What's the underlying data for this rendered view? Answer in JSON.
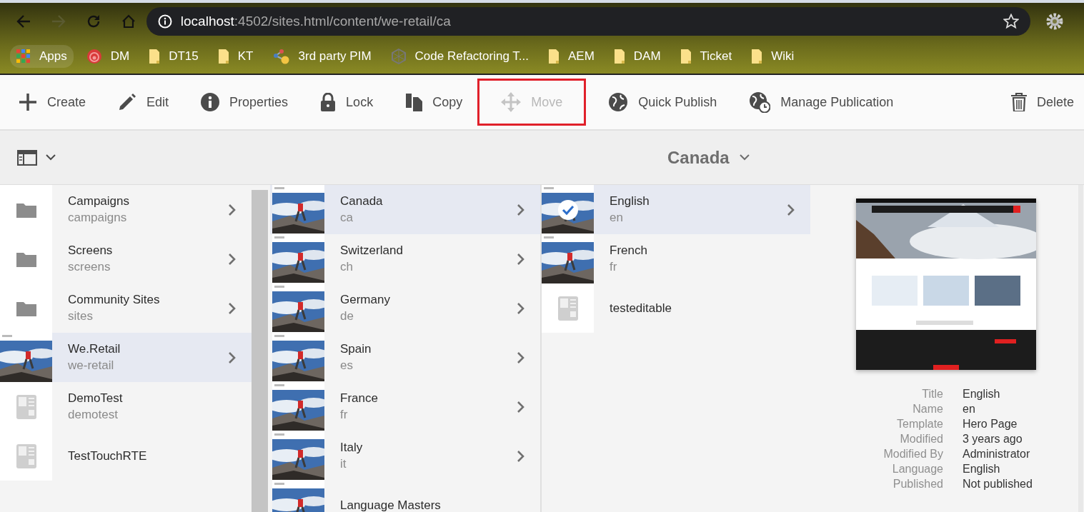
{
  "browser": {
    "address": {
      "host": "localhost",
      "path": ":4502/sites.html/content/we-retail/ca"
    },
    "bookmarks": [
      {
        "label": "Apps",
        "kind": "apps"
      },
      {
        "label": "DM",
        "kind": "target"
      },
      {
        "label": "DT15",
        "kind": "folder"
      },
      {
        "label": "KT",
        "kind": "folder"
      },
      {
        "label": "3rd party PIM",
        "kind": "nodes"
      },
      {
        "label": "Code Refactoring T...",
        "kind": "hexagon"
      },
      {
        "label": "AEM",
        "kind": "folder"
      },
      {
        "label": "DAM",
        "kind": "folder"
      },
      {
        "label": "Ticket",
        "kind": "folder"
      },
      {
        "label": "Wiki",
        "kind": "folder"
      }
    ]
  },
  "toolbar": [
    {
      "label": "Create",
      "kind": "plus",
      "disabled": false,
      "outlined": false
    },
    {
      "label": "Edit",
      "kind": "pencil",
      "disabled": false,
      "outlined": false
    },
    {
      "label": "Properties",
      "kind": "info",
      "disabled": false,
      "outlined": false
    },
    {
      "label": "Lock",
      "kind": "lock",
      "disabled": false,
      "outlined": false
    },
    {
      "label": "Copy",
      "kind": "copy",
      "disabled": false,
      "outlined": false
    },
    {
      "label": "Move",
      "kind": "move",
      "disabled": true,
      "outlined": true
    },
    {
      "label": "Quick Publish",
      "kind": "globe",
      "disabled": false,
      "outlined": false
    },
    {
      "label": "Manage Publication",
      "kind": "globe-clock",
      "disabled": false,
      "outlined": false
    },
    {
      "label": "Delete",
      "kind": "trash",
      "disabled": false,
      "outlined": false
    }
  ],
  "header": {
    "title": "Canada"
  },
  "columns": [
    {
      "items": [
        {
          "title": "Campaigns",
          "name": "campaigns",
          "kind": "folder",
          "selected": false,
          "has_children": true,
          "checked": false
        },
        {
          "title": "Screens",
          "name": "screens",
          "kind": "folder",
          "selected": false,
          "has_children": true,
          "checked": false
        },
        {
          "title": "Community Sites",
          "name": "sites",
          "kind": "folder",
          "selected": false,
          "has_children": true,
          "checked": false
        },
        {
          "title": "We.Retail",
          "name": "we-retail",
          "kind": "picture",
          "selected": true,
          "has_children": true,
          "checked": false
        },
        {
          "title": "DemoTest",
          "name": "demotest",
          "kind": "template",
          "selected": false,
          "has_children": false,
          "checked": false
        },
        {
          "title": "TestTouchRTE",
          "kind": "template",
          "selected": false,
          "has_children": false,
          "checked": false
        }
      ]
    },
    {
      "items": [
        {
          "title": "Canada",
          "name": "ca",
          "kind": "picture",
          "selected": true,
          "has_children": true,
          "checked": false
        },
        {
          "title": "Switzerland",
          "name": "ch",
          "kind": "picture",
          "selected": false,
          "has_children": true,
          "checked": false
        },
        {
          "title": "Germany",
          "name": "de",
          "kind": "picture",
          "selected": false,
          "has_children": true,
          "checked": false
        },
        {
          "title": "Spain",
          "name": "es",
          "kind": "picture",
          "selected": false,
          "has_children": true,
          "checked": false
        },
        {
          "title": "France",
          "name": "fr",
          "kind": "picture",
          "selected": false,
          "has_children": true,
          "checked": false
        },
        {
          "title": "Italy",
          "name": "it",
          "kind": "picture",
          "selected": false,
          "has_children": true,
          "checked": false
        },
        {
          "title": "Language Masters",
          "kind": "picture",
          "selected": false,
          "has_children": false,
          "checked": false
        }
      ]
    },
    {
      "items": [
        {
          "title": "English",
          "name": "en",
          "kind": "picture",
          "selected": true,
          "has_children": true,
          "checked": true
        },
        {
          "title": "French",
          "name": "fr",
          "kind": "picture",
          "selected": false,
          "has_children": false,
          "checked": false
        },
        {
          "title": "testeditable",
          "kind": "template",
          "selected": false,
          "has_children": false,
          "checked": false
        }
      ]
    }
  ],
  "preview": {
    "kind": "picture",
    "properties": [
      {
        "label": "Title",
        "value": "English"
      },
      {
        "label": "Name",
        "value": "en"
      },
      {
        "label": "Template",
        "value": "Hero Page"
      },
      {
        "label": "Modified",
        "value": "3 years ago"
      },
      {
        "label": "Modified By",
        "value": "Administrator"
      },
      {
        "label": "Language",
        "value": "English"
      },
      {
        "label": "Published",
        "value": "Not published"
      }
    ]
  }
}
